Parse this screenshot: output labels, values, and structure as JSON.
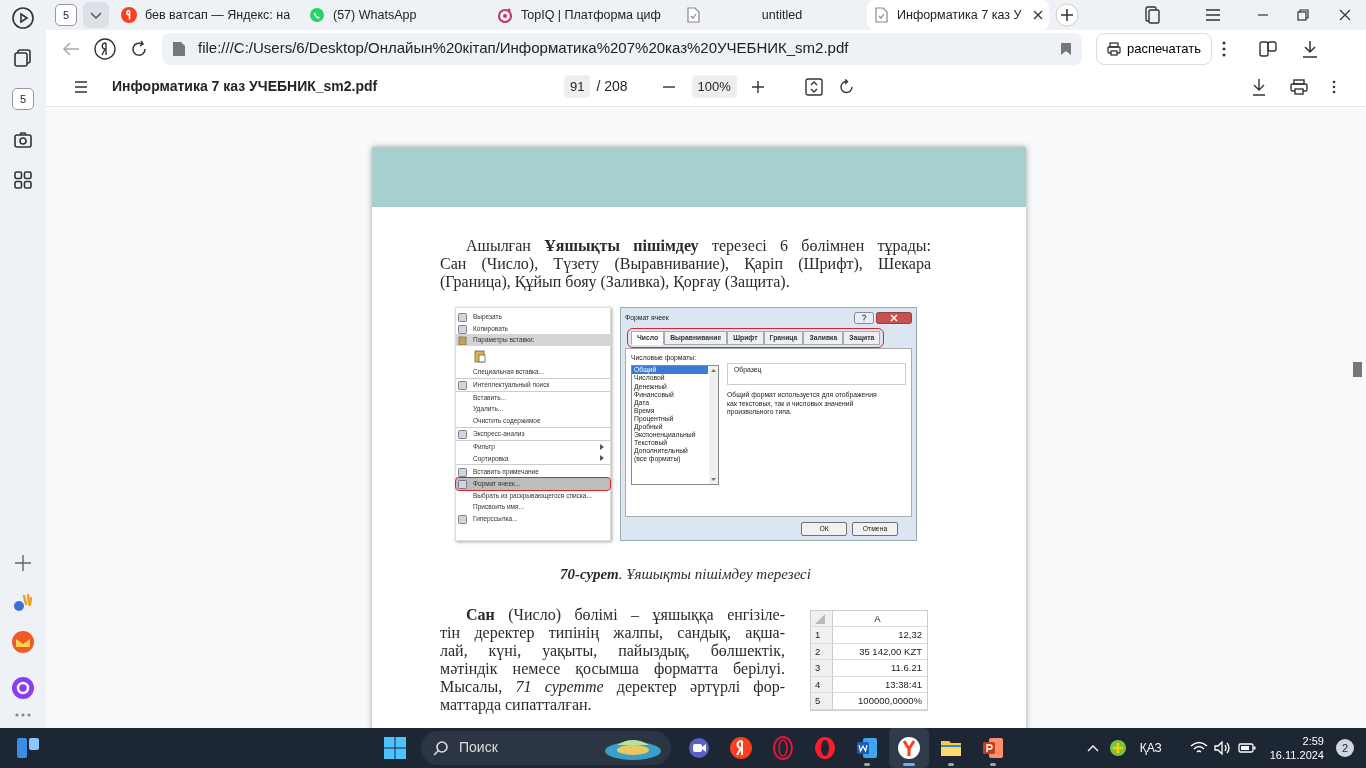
{
  "browser": {
    "tab_count": "5",
    "tabs": [
      {
        "label": "бев ватсап — Яндекс: на",
        "kind": "yandex",
        "selected": false
      },
      {
        "label": "(57) WhatsApp",
        "kind": "whatsapp",
        "selected": false
      },
      {
        "label": "TopIQ | Платформа циф",
        "kind": "topiq",
        "selected": false
      },
      {
        "label": "untitled",
        "kind": "file",
        "selected": false
      },
      {
        "label": "Информатика 7 каз У",
        "kind": "file",
        "selected": true
      }
    ],
    "address": "file:///C:/Users/6/Desktop/Онлайын%20кітап/Информатика%207%20каз%20УЧЕБНИК_sm2.pdf",
    "print_button": "распечатать"
  },
  "sidebar": {
    "badge": "5"
  },
  "pdf_toolbar": {
    "title": "Информатика 7 каз УЧЕБНИК_sm2.pdf",
    "page": "91",
    "total": "/ 208",
    "zoom": "100%"
  },
  "document": {
    "intro": [
      "Ашылған **Ұяшықты пішімдеу** терезесі 6 бөлімнен тұрады:",
      "Сан (Число), Түзету (Выравнивание), Қаріп (Шрифт), Шекара",
      "(Граница), Құйып бояу (Заливка), Қорғау (Защита)."
    ],
    "context_menu": [
      {
        "kind": "item",
        "label": "Вырезать",
        "icon": true,
        "submenu": false,
        "selected": false,
        "separator_after": false
      },
      {
        "kind": "item",
        "label": "Копировать",
        "icon": true,
        "submenu": false,
        "selected": false,
        "separator_after": false
      },
      {
        "kind": "header",
        "label": "Параметры вставки:"
      },
      {
        "kind": "icon-row"
      },
      {
        "kind": "item",
        "label": "Специальная вставка...",
        "icon": false,
        "submenu": false,
        "selected": false,
        "separator_after": true
      },
      {
        "kind": "item",
        "label": "Интеллектуальный поиск",
        "icon": true,
        "submenu": false,
        "selected": false,
        "separator_after": true
      },
      {
        "kind": "item",
        "label": "Вставить...",
        "icon": false,
        "submenu": false,
        "selected": false,
        "separator_after": false
      },
      {
        "kind": "item",
        "label": "Удалить...",
        "icon": false,
        "submenu": false,
        "selected": false,
        "separator_after": false
      },
      {
        "kind": "item",
        "label": "Очистить содержимое",
        "icon": false,
        "submenu": false,
        "selected": false,
        "separator_after": true
      },
      {
        "kind": "item",
        "label": "Экспресс-анализ",
        "icon": true,
        "submenu": false,
        "selected": false,
        "separator_after": true
      },
      {
        "kind": "item",
        "label": "Фильтр",
        "icon": false,
        "submenu": true,
        "selected": false,
        "separator_after": false
      },
      {
        "kind": "item",
        "label": "Сортировка",
        "icon": false,
        "submenu": true,
        "selected": false,
        "separator_after": true
      },
      {
        "kind": "item",
        "label": "Вставить примечание",
        "icon": true,
        "submenu": false,
        "selected": false,
        "separator_after": true
      },
      {
        "kind": "item",
        "label": "Формат ячеек...",
        "icon": true,
        "submenu": false,
        "selected": true,
        "separator_after": false
      },
      {
        "kind": "item",
        "label": "Выбрать из раскрывающегося списка...",
        "icon": false,
        "submenu": false,
        "selected": false,
        "separator_after": false
      },
      {
        "kind": "item",
        "label": "Присвоить имя...",
        "icon": false,
        "submenu": false,
        "selected": false,
        "separator_after": false
      },
      {
        "kind": "item",
        "label": "Гиперссылка...",
        "icon": true,
        "submenu": false,
        "selected": false,
        "separator_after": false
      }
    ],
    "dialog": {
      "title": "Формат ячеек",
      "tabs": [
        {
          "label": "Число",
          "selected": true
        },
        {
          "label": "Выравнивание",
          "selected": false
        },
        {
          "label": "Шрифт",
          "selected": false
        },
        {
          "label": "Граница",
          "selected": false
        },
        {
          "label": "Заливка",
          "selected": false
        },
        {
          "label": "Защита",
          "selected": false
        }
      ],
      "list_label": "Числовые форматы:",
      "formats": [
        {
          "label": "Общий",
          "selected": true
        },
        {
          "label": "Числовой",
          "selected": false
        },
        {
          "label": "Денежный",
          "selected": false
        },
        {
          "label": "Финансовый",
          "selected": false
        },
        {
          "label": "Дата",
          "selected": false
        },
        {
          "label": "Время",
          "selected": false
        },
        {
          "label": "Процентный",
          "selected": false
        },
        {
          "label": "Дробный",
          "selected": false
        },
        {
          "label": "Экспоненциальный",
          "selected": false
        },
        {
          "label": "Текстовый",
          "selected": false
        },
        {
          "label": "Дополнительный",
          "selected": false
        },
        {
          "label": "(все форматы)",
          "selected": false
        }
      ],
      "sample_label": "Образец",
      "description": "Общий формат используется для отображения как текстовых, так и числовых значений произвольного типа.",
      "buttons": [
        "ОК",
        "Отмена"
      ]
    },
    "caption": "**70-сурет**. Ұяшықты пішімдеу терезесі",
    "body": [
      "**Сан** (Число) бөлімі – ұяшыққа енгізіле-",
      "тін деректер типінің жалпы, сандық, ақша-",
      "лай, күні, уақыты, пайыздық, бөлшектік,",
      "мәтіндік немесе қосымша форматта берілуі.",
      "Мысалы, *71 суретте* деректер әртүрлі фор-",
      "маттарда сипатталған."
    ],
    "sheet": {
      "column": "A",
      "rows": [
        {
          "number": "1",
          "value": "12,32"
        },
        {
          "number": "2",
          "value": "35 142,00 KZT"
        },
        {
          "number": "3",
          "value": "11.6.21"
        },
        {
          "number": "4",
          "value": "13:38:41"
        },
        {
          "number": "5",
          "value": "100000,0000%"
        }
      ]
    }
  },
  "taskbar": {
    "search": "Поиск",
    "apps": [
      {
        "kind": "meet",
        "running": false,
        "active": false
      },
      {
        "kind": "yandex",
        "running": false,
        "active": false
      },
      {
        "kind": "opera-gx",
        "running": false,
        "active": false
      },
      {
        "kind": "opera",
        "running": false,
        "active": false
      },
      {
        "kind": "word",
        "running": true,
        "active": false
      },
      {
        "kind": "yandex-browser",
        "running": true,
        "active": true
      },
      {
        "kind": "files",
        "running": true,
        "active": false
      },
      {
        "kind": "powerpoint",
        "running": true,
        "active": false
      }
    ],
    "language": "ҚАЗ",
    "time": "2:59",
    "date": "16.11.2024",
    "notifications": "2"
  }
}
